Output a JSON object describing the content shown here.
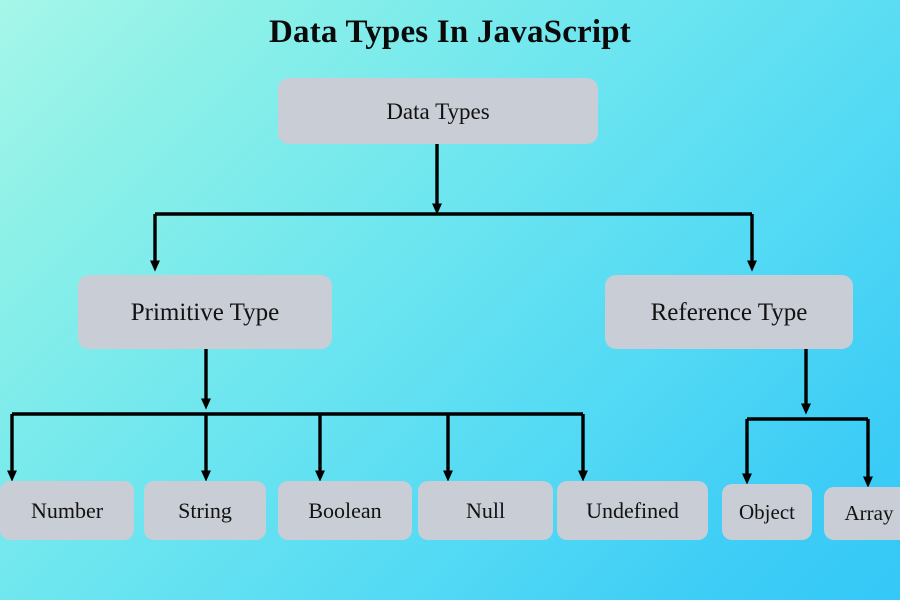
{
  "title": "Data Types In JavaScript",
  "colors": {
    "background_start": "#a6f6e9",
    "background_end": "#35c8f7",
    "node_fill": "#c9cdd5",
    "text": "#121212",
    "connector": "#000000"
  },
  "diagram": {
    "root": {
      "label": "Data Types"
    },
    "level1": [
      {
        "label": "Primitive Type"
      },
      {
        "label": "Reference Type"
      }
    ],
    "primitive_children": [
      {
        "label": "Number"
      },
      {
        "label": "String"
      },
      {
        "label": "Boolean"
      },
      {
        "label": "Null"
      },
      {
        "label": "Undefined"
      }
    ],
    "reference_children": [
      {
        "label": "Object"
      },
      {
        "label": "Array"
      }
    ]
  }
}
